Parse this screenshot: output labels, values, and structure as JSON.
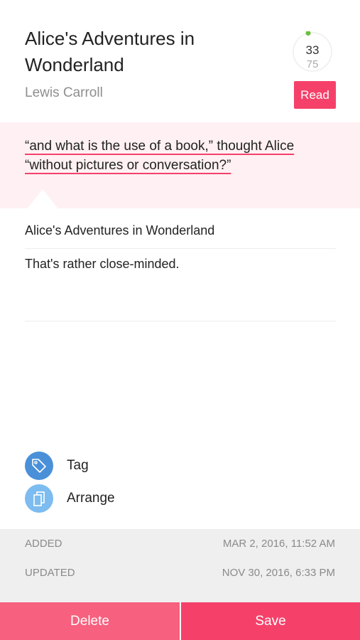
{
  "book": {
    "title": "Alice's Adventures in Wonderland",
    "author": "Lewis Carroll",
    "progress": {
      "current": "33",
      "total": "75",
      "fraction": 0.44
    },
    "status_badge": "Read"
  },
  "quote": {
    "line1": "“and what is the use of a book,” thought Alice",
    "line2": "“without pictures or conversation?”"
  },
  "note": {
    "source": "Alice's Adventures in Wonderland",
    "text": "That's rather close-minded."
  },
  "actions": {
    "tag_label": "Tag",
    "arrange_label": "Arrange"
  },
  "meta": {
    "added_label": "ADDED",
    "added_value": "MAR 2, 2016, 11:52 AM",
    "updated_label": "UPDATED",
    "updated_value": "NOV 30, 2016, 6:33 PM"
  },
  "footer": {
    "delete_label": "Delete",
    "save_label": "Save"
  },
  "colors": {
    "accent": "#f5416a",
    "delete": "#f7607e",
    "quote_bg": "#fff1f3",
    "tag_icon": "#4a90d9",
    "arrange_icon": "#7cbcf0",
    "progress_dot": "#6abf3c"
  },
  "icons": {
    "tag": "tag-icon",
    "arrange": "arrange-icon"
  }
}
